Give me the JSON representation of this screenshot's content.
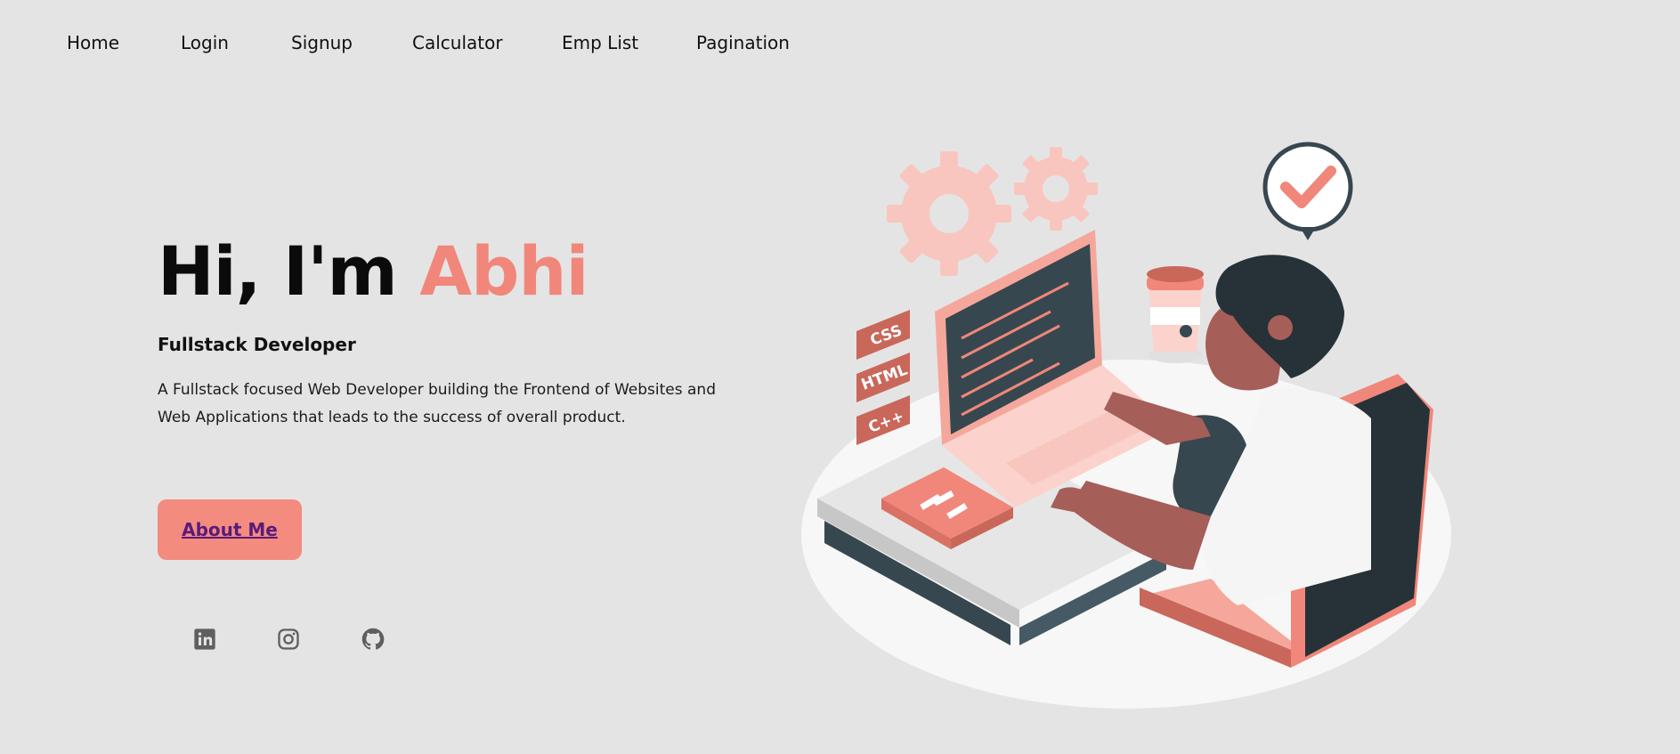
{
  "nav": {
    "items": [
      "Home",
      "Login",
      "Signup",
      "Calculator",
      "Emp List",
      "Pagination"
    ]
  },
  "hero": {
    "greeting_prefix": "Hi, I'm ",
    "greeting_name": "Abhi",
    "role": "Fullstack Developer",
    "description": "A Fullstack focused Web Developer building the Frontend of Websites and Web Applications that leads to the success of overall product.",
    "cta_label": "About Me"
  },
  "illustration": {
    "badges": [
      "CSS",
      "HTML",
      "C++"
    ]
  },
  "social": {
    "icons": [
      "linkedin-icon",
      "instagram-icon",
      "github-icon"
    ]
  },
  "colors": {
    "background": "#e5e4e4",
    "accent": "#f0877a",
    "button": "#f38b7f",
    "button_text": "#5a1b7a",
    "icon_gray": "#5f5f5f"
  }
}
